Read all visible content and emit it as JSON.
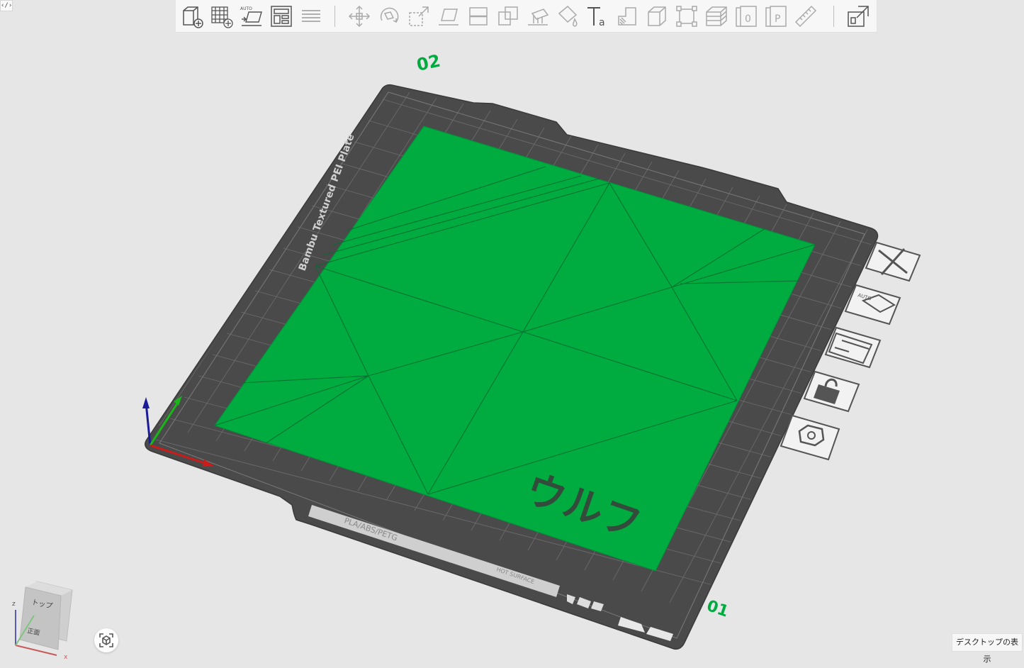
{
  "corner_button": {
    "label": "‹/›"
  },
  "toolbar": {
    "groups": [
      [
        "add-part",
        "add-plate",
        "auto-arrange",
        "plate-layout",
        "layers"
      ],
      [
        "move",
        "rotate",
        "scale",
        "lay-flat",
        "cut",
        "boolean",
        "support-paint",
        "color-paint",
        "text",
        "measure-height",
        "cube-view",
        "bounding",
        "slice-layers",
        "object-0",
        "object-p",
        "ruler"
      ],
      [
        "assembly"
      ]
    ]
  },
  "bed": {
    "brand_text": "Bambu Textured PEI Plate",
    "material_text": "PLA/ABS/PETG",
    "hot_surface_text": "HOT SURFACE",
    "plate_number_top": "02",
    "plate_number_bottom": "01",
    "model_text": "ウルフ",
    "model_color": "#00ab40",
    "bed_color": "#4a4a4a"
  },
  "side_buttons": [
    "close-icon",
    "auto-orient-icon",
    "arrange-icon",
    "lock-icon",
    "settings-icon"
  ],
  "orientation_cube": {
    "top_label": "トップ",
    "front_label": "正面",
    "axes": [
      "z",
      "x"
    ]
  },
  "tooltip": {
    "text": "デスクトップの表示"
  }
}
